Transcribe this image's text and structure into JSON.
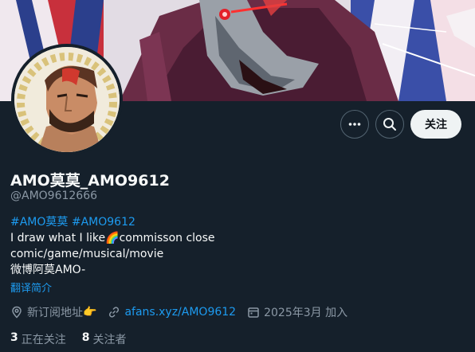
{
  "profile": {
    "display_name": "AMO莫莫_AMO9612",
    "handle": "@AMO9612666",
    "bio": {
      "hashtag_1": "#AMO莫莫",
      "hashtag_2": "#AMO9612",
      "line2_before": "I draw what I like",
      "line2_emoji": "🌈",
      "line2_after": "commisson close",
      "line3": "comic/game/musical/movie",
      "line4": "微博阿莫AMO-"
    },
    "translate_label": "翻译简介",
    "location": "新订阅地址",
    "location_emoji": "👉",
    "website": "afans.xyz/AMO9612",
    "joined": "2025年3月 加入",
    "following_count": "3",
    "following_label": "正在关注",
    "followers_count": "8",
    "followers_label": "关注者"
  },
  "actions": {
    "follow_label": "关注"
  },
  "icons": {
    "more": "more-icon",
    "search": "search-icon",
    "location": "location-pin-icon",
    "link": "link-icon",
    "calendar": "calendar-icon"
  },
  "colors": {
    "background": "#15202b",
    "accent": "#1d9bf0",
    "muted": "#8b98a5",
    "follow_button_bg": "#eff3f4"
  }
}
